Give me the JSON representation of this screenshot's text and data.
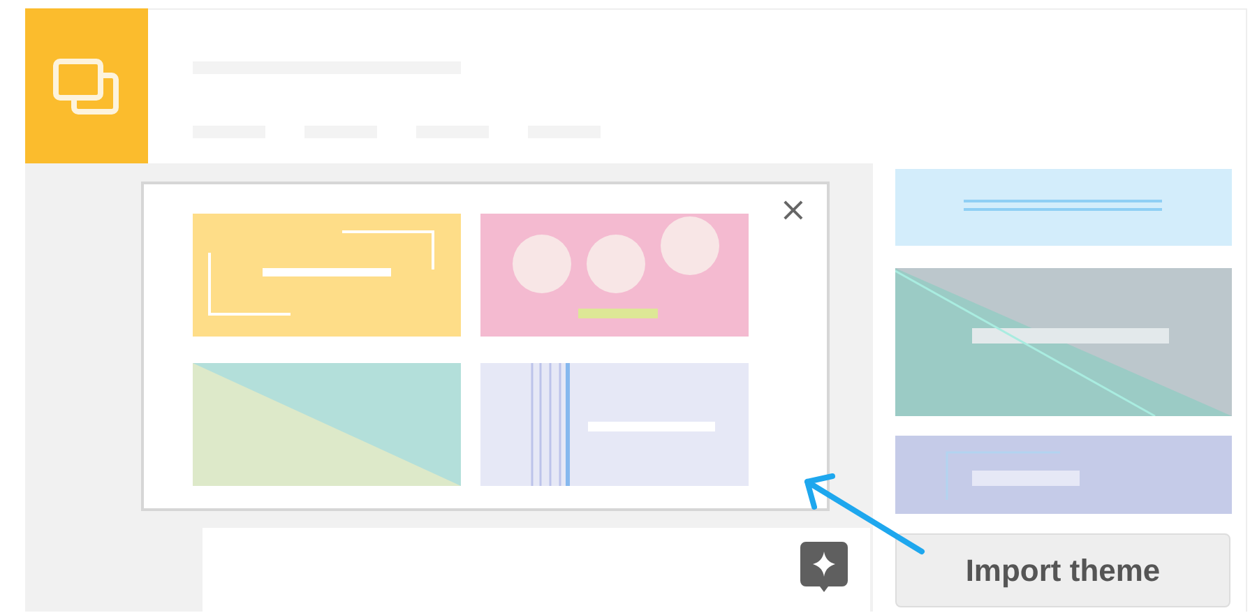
{
  "dialog": {
    "close": {
      "label": "×"
    },
    "themes": [
      {
        "kind": "yellow-frame"
      },
      {
        "kind": "pink-circles"
      },
      {
        "kind": "diagonal-split"
      },
      {
        "kind": "lavender-stripes"
      }
    ]
  },
  "side_panel": {
    "themes": [
      {
        "kind": "sky-lines"
      },
      {
        "kind": "teal-diagonal"
      },
      {
        "kind": "violet-corner"
      }
    ],
    "import_button": {
      "label": "Import theme"
    }
  }
}
